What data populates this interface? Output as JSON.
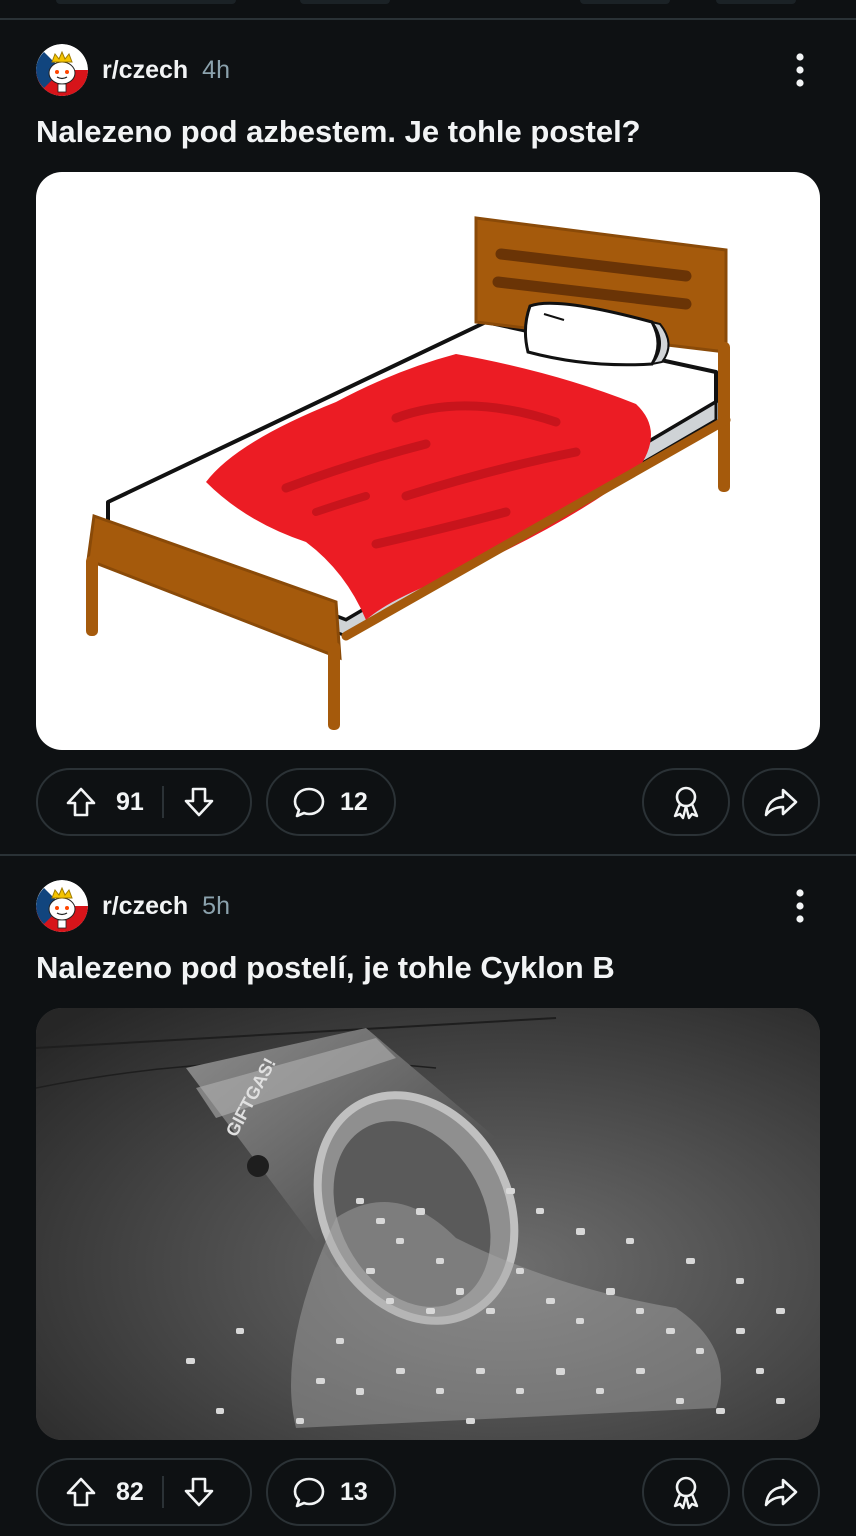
{
  "posts": [
    {
      "subreddit": "r/czech",
      "age": "4h",
      "title": "Nalezeno pod azbestem. Je tohle postel?",
      "image_description": "Hand-drawn bed with brown frame, white mattress, red blanket and pillow",
      "upvotes": "91",
      "comments": "12"
    },
    {
      "subreddit": "r/czech",
      "age": "5h",
      "title": "Nalezeno pod postelí, je tohle Cyklon B",
      "image_description": "Black and white photo of a tipped-over can spilling pellets",
      "can_label": "GIFTGAS!",
      "upvotes": "82",
      "comments": "13"
    }
  ],
  "icons": {
    "more": "vertical-ellipsis-icon",
    "upvote": "arrow-up-icon",
    "downvote": "arrow-down-icon",
    "comment": "speech-bubble-icon",
    "award": "award-ribbon-icon",
    "share": "share-arrow-icon"
  },
  "colors": {
    "background": "#0e1113",
    "text": "#f2f4f5",
    "meta": "#8ba2ad",
    "border": "#2b3236"
  }
}
